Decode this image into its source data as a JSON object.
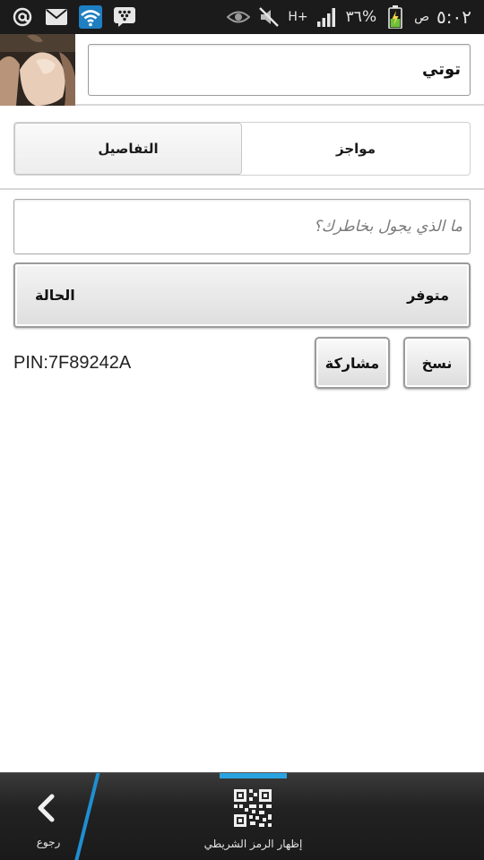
{
  "status_bar": {
    "time": "٥:٠٢",
    "am_pm": "ص",
    "battery": "٣٦%",
    "network": "H+",
    "left_icons": [
      "at-icon",
      "mail-icon",
      "wifi-icon",
      "bbm-icon"
    ],
    "right_icons": [
      "eye-icon",
      "mute-icon",
      "signal-icon",
      "battery-icon"
    ],
    "wifi_color": "#1e7fc2"
  },
  "header": {
    "display_name": "توتي"
  },
  "tabs": {
    "bar_label": "مواجز",
    "details_label": "التفاصيل"
  },
  "mood": {
    "placeholder": "ما الذي يجول بخاطرك؟"
  },
  "status": {
    "label": "الحالة",
    "value": "متوفر"
  },
  "actions": {
    "copy_label": "نسخ",
    "share_label": "مشاركة",
    "pin": "PIN:7F89242A"
  },
  "bottom_bar": {
    "back_label": "رجوع",
    "qr_label": "إظهار الرمز الشريطي",
    "accent_color": "#2aa4e0"
  }
}
